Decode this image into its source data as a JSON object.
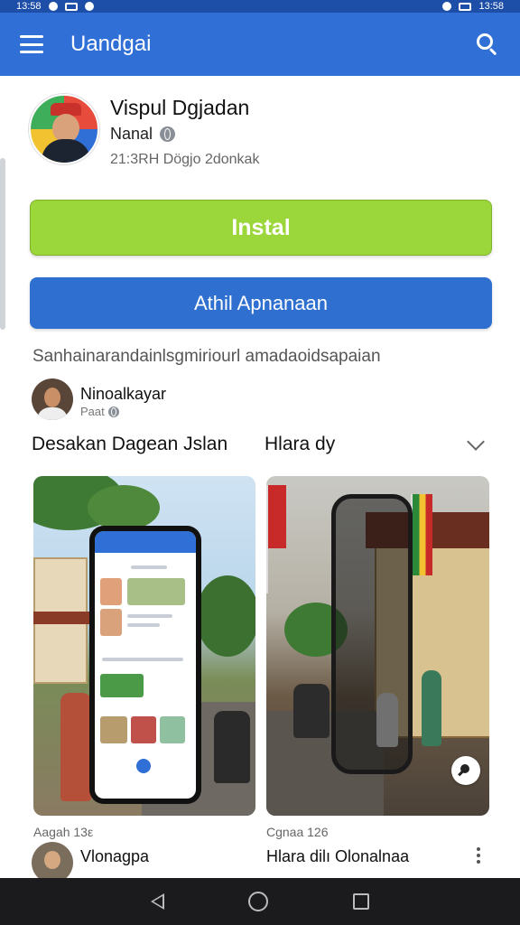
{
  "status_bar": {
    "time_left": "13:58",
    "time_right": "13:58"
  },
  "app_bar": {
    "title": "Uandgai",
    "menu_icon": "hamburger-menu-icon",
    "search_icon": "search-icon"
  },
  "profile": {
    "name": "Vispul Dgjadan",
    "subtitle": "Nanal",
    "meta": "21:3RH Dögjo 2donkak"
  },
  "buttons": {
    "install": "Instal",
    "secondary": "Athil Apnanaan"
  },
  "tagline": "Sanhainarandainlsgmiriourl amadaoidsapaian",
  "poster": {
    "name": "Ninoalkayar",
    "subtitle": "Paat"
  },
  "section": {
    "left_title": "Desakan Dagean Jslan",
    "right_title": "Hlara dy"
  },
  "cards": [
    {
      "caption": "Aagah 13ε"
    },
    {
      "caption": "Cgnaa 126"
    }
  ],
  "bottom_poster": {
    "name": "Vlonagpa",
    "title": "Hlara dilı Olonalnaa"
  },
  "colors": {
    "app_bar": "#2f6fd6",
    "install": "#9bd63a",
    "secondary": "#2e6fd0",
    "nav_bar": "#1b1b1d"
  }
}
